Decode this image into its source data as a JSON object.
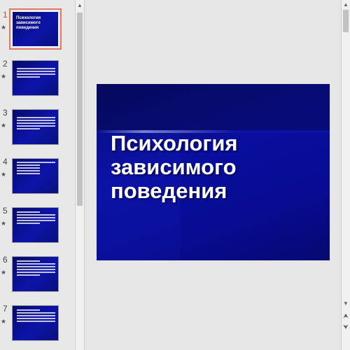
{
  "slides": [
    {
      "num": "1",
      "title": "Психология зависимого поведения",
      "active": true
    },
    {
      "num": "2",
      "title": "",
      "active": false
    },
    {
      "num": "3",
      "title": "",
      "active": false
    },
    {
      "num": "4",
      "title": "",
      "active": false
    },
    {
      "num": "5",
      "title": "",
      "active": false
    },
    {
      "num": "6",
      "title": "",
      "active": false
    },
    {
      "num": "7",
      "title": "",
      "active": false
    }
  ],
  "star_glyph": "★",
  "main_slide": {
    "title": "Психология зависимого поведения"
  },
  "scroll": {
    "up": "▲",
    "down": "▼",
    "prev_slide": "⮝",
    "next_slide": "⮟"
  }
}
